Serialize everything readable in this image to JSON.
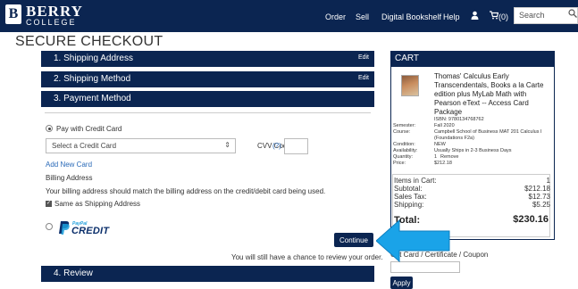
{
  "header": {
    "logo_main": "BERRY",
    "logo_sub": "COLLEGE",
    "logo_icon": "B",
    "nav": [
      "Order",
      "Sell",
      "Digital Bookshelf",
      "Help"
    ],
    "cart_count": "(0)",
    "search_placeholder": "Search"
  },
  "page_title": "SECURE CHECKOUT",
  "sections": {
    "shipping_address": "1. Shipping Address",
    "shipping_method": "2. Shipping Method",
    "payment_method": "3. Payment Method",
    "review": "4. Review",
    "edit_label": "Edit"
  },
  "payment": {
    "pay_credit_label": "Pay with Credit Card",
    "select_placeholder": "Select a Credit Card",
    "cvv_label": "CVV Code",
    "cvv_help": "(?)",
    "add_card": "Add New Card",
    "billing_heading": "Billing Address",
    "billing_note": "Your billing address should match the billing address on the credit/debit card being used.",
    "same_as_shipping": "Same as Shipping Address",
    "paypal_small": "PayPal",
    "paypal_big": "CREDIT",
    "continue": "Continue",
    "review_note": "You will still have a chance to review your order."
  },
  "cart": {
    "title": "CART",
    "book_title": "Thomas' Calculus Early Transcendentals, Books a la Carte edition plus MyLab Math with Pearson eText -- Access Card Package",
    "isbn": "ISBN: 9780134768762",
    "details": [
      {
        "key": "Semester:",
        "value": "Fall 2020"
      },
      {
        "key": "Course:",
        "value": "Campbell School of Business MAT 201 Calculus I (Foundations F2a)"
      },
      {
        "key": "Condition:",
        "value": "NEW"
      },
      {
        "key": "Availability:",
        "value": "Usually Ships in 2-3 Business Days"
      },
      {
        "key": "Quantity:",
        "value": "1"
      },
      {
        "key": "Price:",
        "value": "$212.18"
      }
    ],
    "remove_label": "Remove",
    "items_in_cart_label": "Items in Cart:",
    "items_in_cart": "1",
    "subtotal_label": "Subtotal:",
    "subtotal": "$212.18",
    "tax_label": "Sales Tax:",
    "tax": "$12.73",
    "shipping_label": "Shipping:",
    "shipping": "$5.25",
    "total_label": "Total:",
    "total": "$230.16",
    "gift_label": "Gift Card / Certificate / Coupon",
    "apply": "Apply"
  },
  "colors": {
    "navy": "#0b2551",
    "link": "#2a6ab8",
    "arrow": "#1aa3e8"
  }
}
